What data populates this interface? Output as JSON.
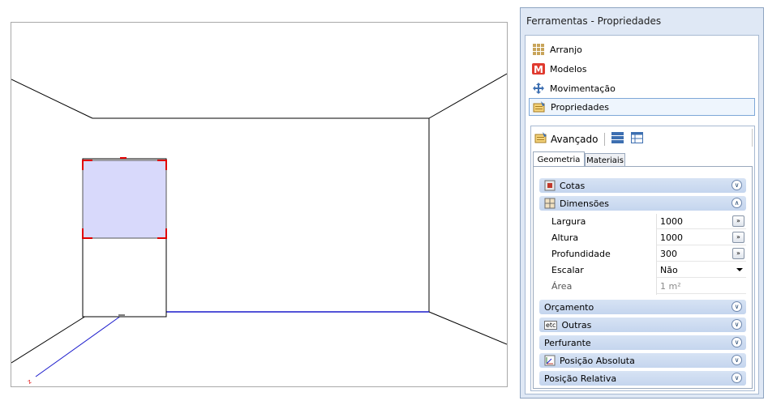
{
  "panel": {
    "title": "Ferramentas - Propriedades",
    "nav": [
      {
        "label": "Arranjo",
        "icon": "grid-icon"
      },
      {
        "label": "Modelos",
        "icon": "m-logo-icon"
      },
      {
        "label": "Movimentação",
        "icon": "move-arrows-icon"
      },
      {
        "label": "Propriedades",
        "icon": "properties-icon",
        "selected": true
      }
    ],
    "advanced": {
      "label": "Avançado",
      "tabs": [
        {
          "label": "Geometria",
          "active": true
        },
        {
          "label": "Materiais"
        }
      ]
    },
    "groups": {
      "cotas": "Cotas",
      "dimensoes": "Dimensões",
      "orcamento": "Orçamento",
      "outras": "Outras",
      "outras_badge": "etc",
      "perfurante": "Perfurante",
      "posicao_absoluta": "Posição Absoluta",
      "posicao_relativa": "Posição Relativa"
    },
    "properties": [
      {
        "label": "Largura",
        "value": "1000",
        "button": "»"
      },
      {
        "label": "Altura",
        "value": "1000",
        "button": "»"
      },
      {
        "label": "Profundidade",
        "value": "300",
        "button": "»"
      },
      {
        "label": "Escalar",
        "value": "Não",
        "dropdown": true
      },
      {
        "label": "Área",
        "value": "1 m²",
        "disabled": true
      }
    ]
  },
  "colors": {
    "accent": "#7ea7d8",
    "group_header": "#c4d5ee",
    "selection": "#d8d9fb",
    "selection_outline": "#e00000",
    "floor_line": "#1a1acc"
  },
  "viewport": {
    "axis_label": "z"
  }
}
